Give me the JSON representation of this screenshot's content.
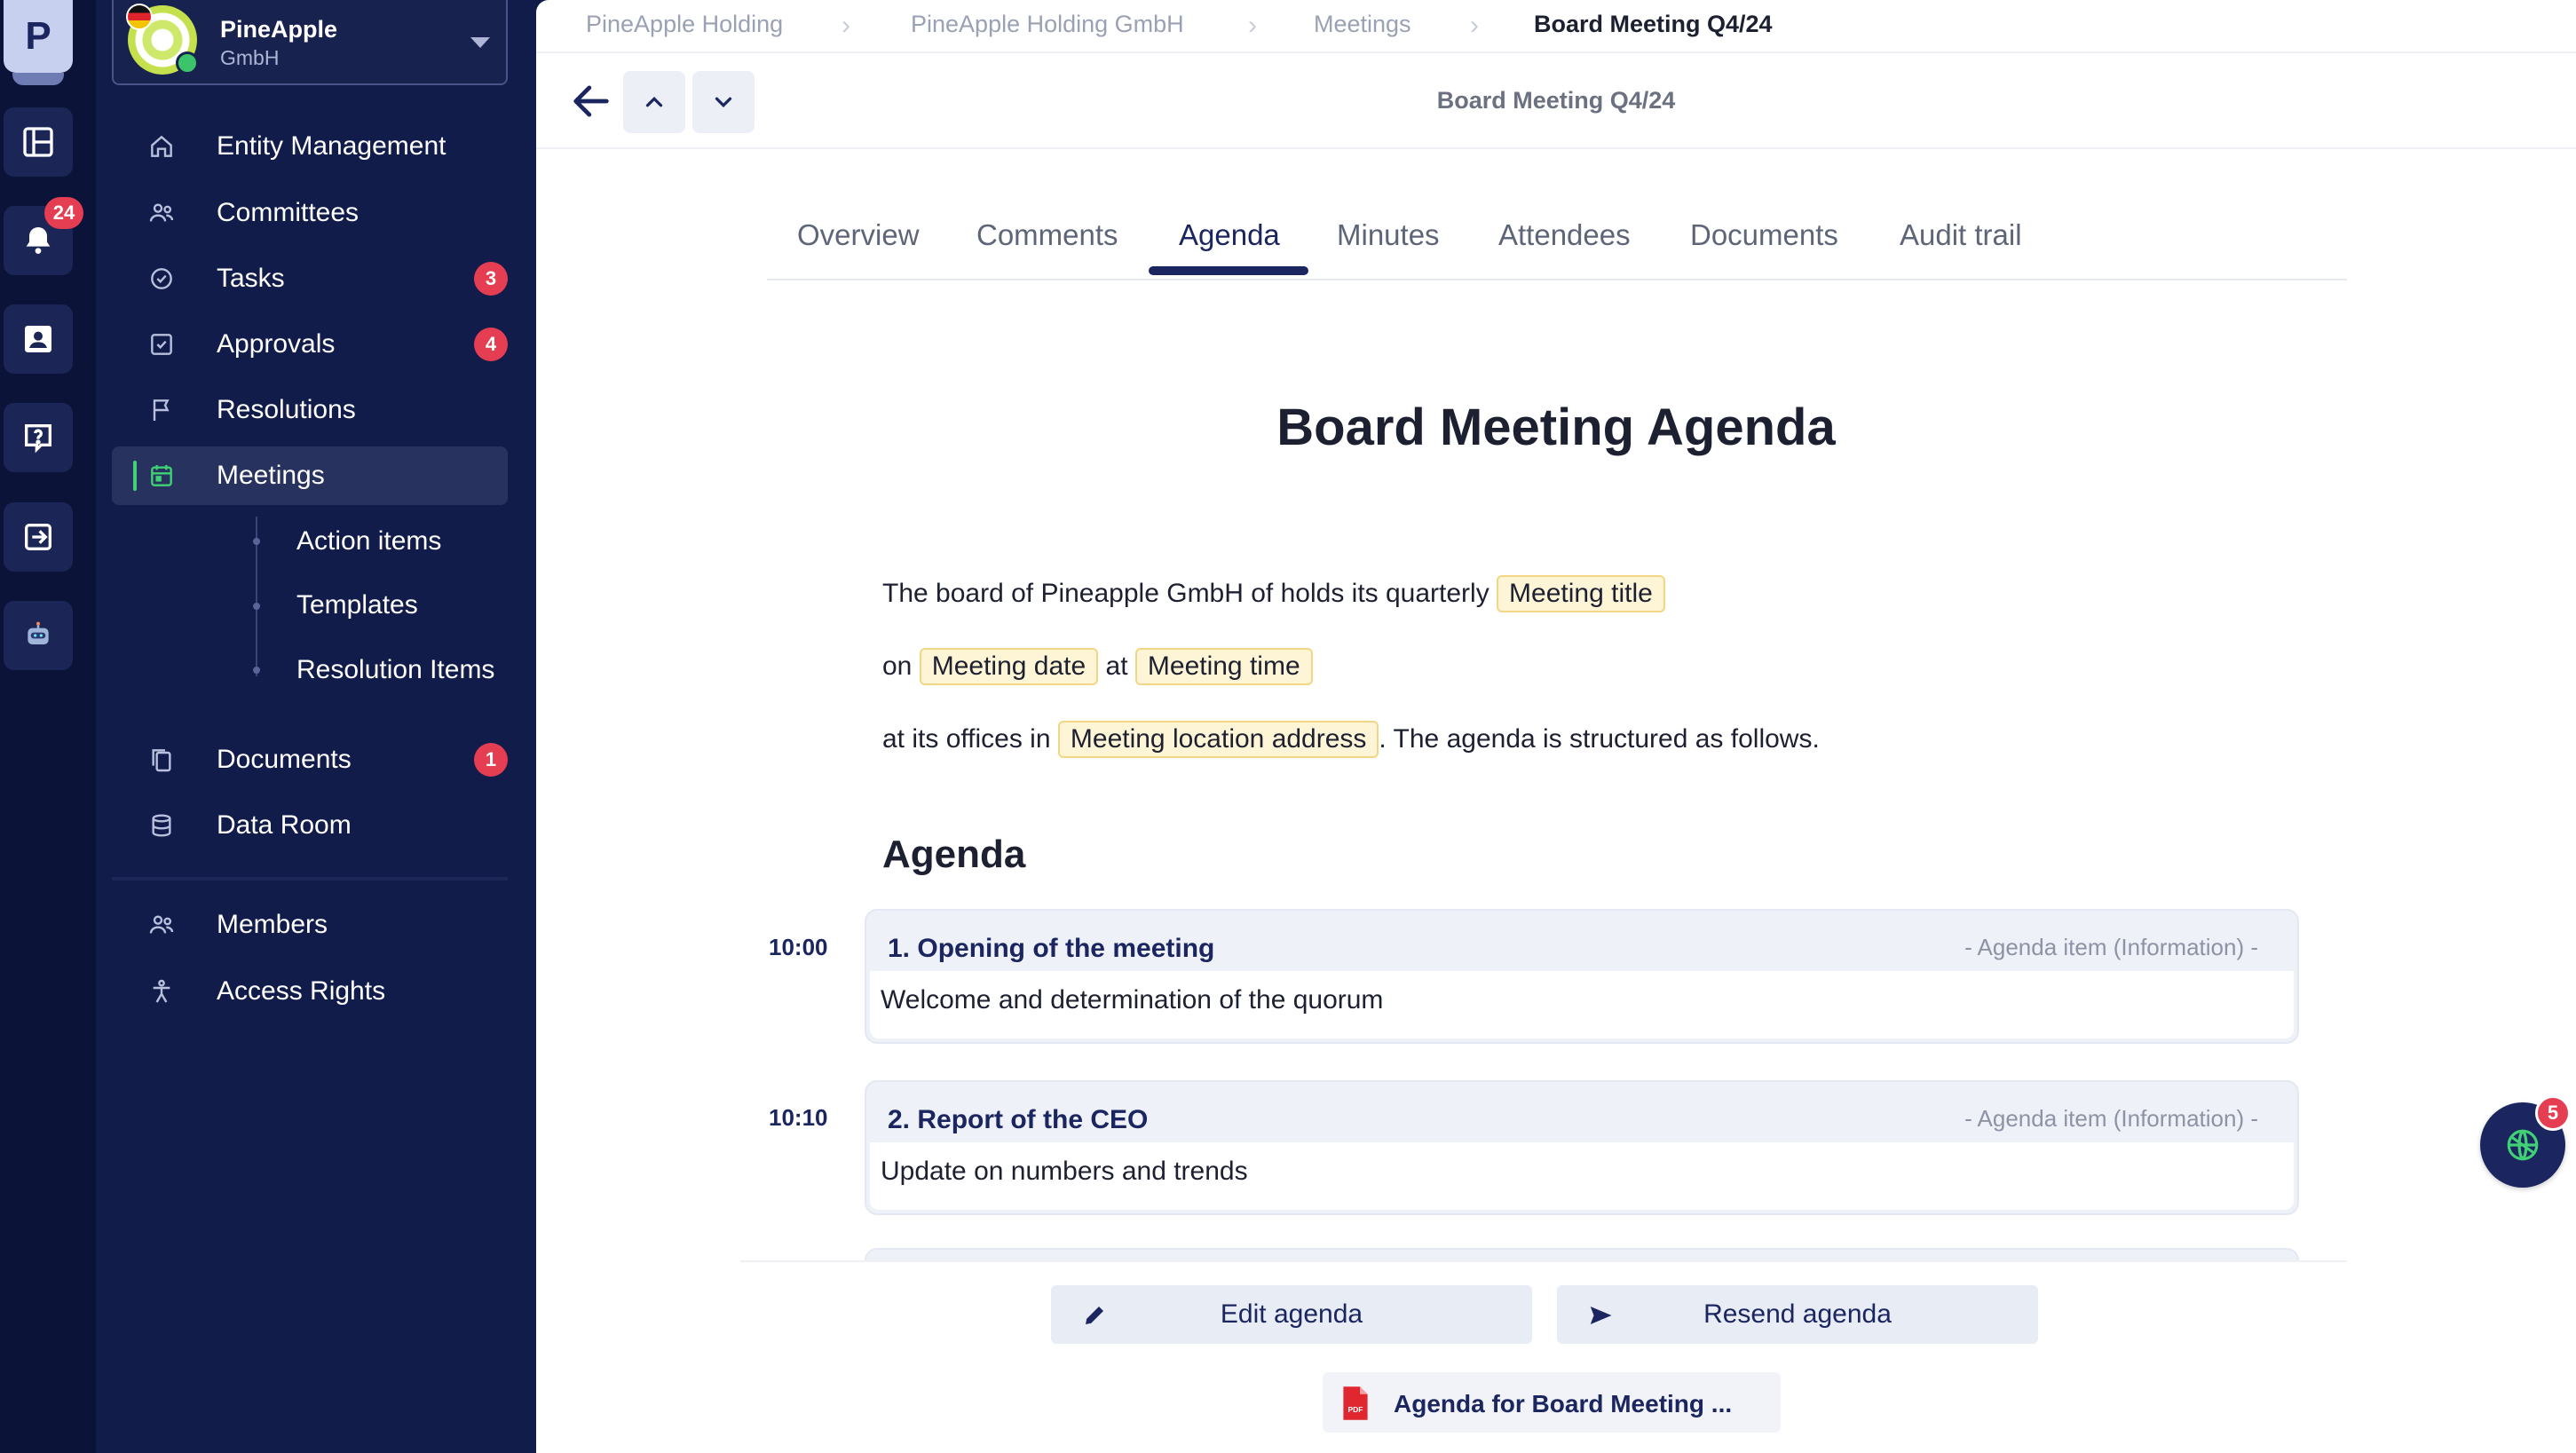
{
  "rail": {
    "logo_letter": "P",
    "notifications_count": "24",
    "items": [
      "dashboard-icon",
      "bell-icon",
      "contact-card-icon",
      "help-icon",
      "login-icon",
      "robot-icon"
    ]
  },
  "org": {
    "name": "PineApple",
    "sub": "GmbH"
  },
  "sidebar": {
    "items": [
      {
        "label": "Entity Management",
        "icon": "home-icon"
      },
      {
        "label": "Committees",
        "icon": "people-icon"
      },
      {
        "label": "Tasks",
        "icon": "check-circle-icon",
        "badge": "3"
      },
      {
        "label": "Approvals",
        "icon": "check-square-icon",
        "badge": "4"
      },
      {
        "label": "Resolutions",
        "icon": "flag-icon"
      },
      {
        "label": "Meetings",
        "icon": "calendar-icon",
        "active": true
      },
      {
        "label": "Documents",
        "icon": "documents-icon",
        "badge": "1"
      },
      {
        "label": "Data Room",
        "icon": "database-icon"
      },
      {
        "label": "Members",
        "icon": "people-icon"
      },
      {
        "label": "Access Rights",
        "icon": "person-star-icon"
      }
    ],
    "sub_items": [
      "Action items",
      "Templates",
      "Resolution Items"
    ]
  },
  "breadcrumb": [
    "PineApple Holding",
    "PineApple Holding GmbH",
    "Meetings",
    "Board Meeting Q4/24"
  ],
  "header": {
    "title": "Board Meeting Q4/24"
  },
  "tabs": [
    "Overview",
    "Comments",
    "Agenda",
    "Minutes",
    "Attendees",
    "Documents",
    "Audit trail"
  ],
  "active_tab": "Agenda",
  "document": {
    "title": "Board Meeting Agenda",
    "line1_text": "The board of Pineapple GmbH of holds its quarterly",
    "tag_meeting_title": "Meeting title",
    "line2_on": "on",
    "tag_meeting_date": "Meeting date",
    "line2_at": "at",
    "tag_meeting_time": "Meeting time",
    "line3_prefix": "at its offices in",
    "tag_meeting_location": "Meeting location address",
    "line3_suffix": ". The agenda is structured as follows.",
    "agenda_heading": "Agenda",
    "items": [
      {
        "time": "10:00",
        "title": "1. Opening of the meeting",
        "type": "- Agenda item (Information) -",
        "description": "Welcome and determination of the quorum"
      },
      {
        "time": "10:10",
        "title": "2. Report of the CEO",
        "type": "- Agenda item (Information) -",
        "description": "Update on numbers and trends"
      }
    ]
  },
  "actions": {
    "edit": "Edit agenda",
    "resend": "Resend agenda"
  },
  "attachment": {
    "label": "Agenda for Board Meeting ...",
    "icon": "pdf-icon"
  },
  "fab": {
    "badge": "5",
    "icon": "globe-icon"
  },
  "colors": {
    "navy": "#1b2660",
    "sidebar": "#111c4a",
    "badge": "#e53e52",
    "active_indicator": "#3fd174",
    "tag_bg": "#fdf5d6"
  }
}
